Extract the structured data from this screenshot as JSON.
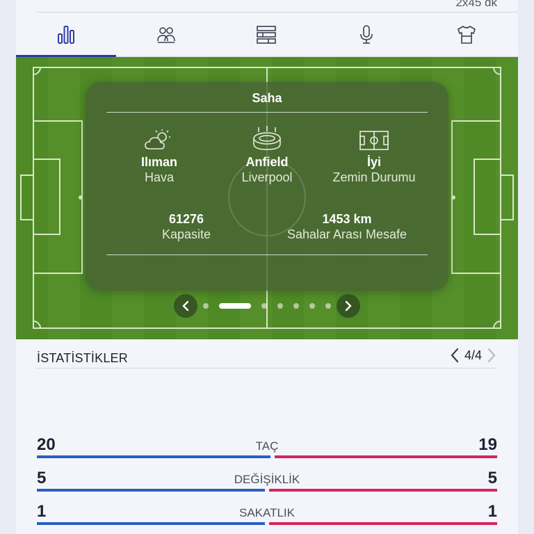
{
  "header": {
    "duration": "2x45 dk"
  },
  "tabs": [
    {
      "id": "stats",
      "icon": "bar-chart-icon",
      "active": true
    },
    {
      "id": "lineups",
      "icon": "players-icon",
      "active": false
    },
    {
      "id": "standings",
      "icon": "table-icon",
      "active": false
    },
    {
      "id": "commentary",
      "icon": "microphone-icon",
      "active": false
    },
    {
      "id": "kits",
      "icon": "jersey-icon",
      "active": false
    }
  ],
  "venue": {
    "title": "Saha",
    "weather": {
      "value": "Ilıman",
      "label": "Hava",
      "icon": "partly-cloudy-icon"
    },
    "stadium": {
      "value": "Anfield",
      "label": "Liverpool",
      "icon": "stadium-icon"
    },
    "pitch": {
      "value": "İyi",
      "label": "Zemin Durumu",
      "icon": "pitch-icon"
    },
    "capacity": {
      "value": "61276",
      "label": "Kapasite"
    },
    "distance": {
      "value": "1453 km",
      "label": "Sahalar Arası Mesafe"
    },
    "carousel": {
      "slides": 8,
      "active_slide": 1
    }
  },
  "stats": {
    "title": "İSTATİSTİKLER",
    "page": "4/4",
    "rows": [
      {
        "name": "TAÇ",
        "home": "20",
        "away": "19"
      },
      {
        "name": "DEĞİŞİKLİK",
        "home": "5",
        "away": "5"
      },
      {
        "name": "SAKATLIK",
        "home": "1",
        "away": "1"
      }
    ]
  },
  "colors": {
    "accent": "#2b3aa8",
    "home": "#2a5fc3",
    "away": "#d6245f",
    "pitch": "#558f2a"
  }
}
